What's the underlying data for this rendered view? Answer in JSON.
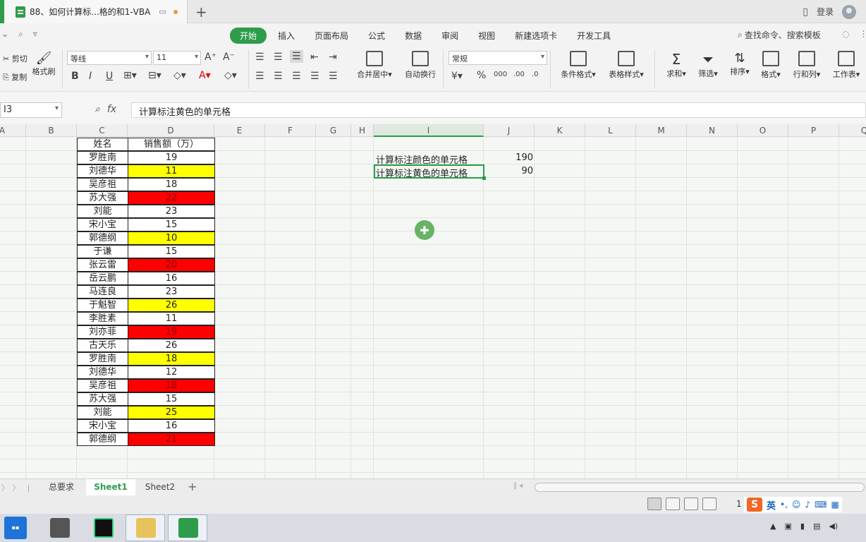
{
  "tab": {
    "title": "88、如何计算标...格的和1-VBA",
    "login": "登录"
  },
  "menu": {
    "left": [
      "⌄",
      "⌕",
      "▿"
    ],
    "items": [
      "开始",
      "插入",
      "页面布局",
      "公式",
      "数据",
      "审阅",
      "视图",
      "新建选项卡",
      "开发工具"
    ],
    "active": "开始",
    "search": "查找命令、搜索模板"
  },
  "ribbon": {
    "cut": "剪切",
    "copy": "复制",
    "format_painter": "格式刷",
    "font": "等线",
    "font_size": "11",
    "number_format": "常规",
    "merge": "合并居中",
    "wrap": "自动换行",
    "cond_format": "条件格式",
    "table_style": "表格样式",
    "sum": "求和",
    "filter": "筛选",
    "sort": "排序",
    "format": "格式",
    "rowcol": "行和列",
    "worksheet": "工作表",
    "bold": "B",
    "italic": "I",
    "underline": "U",
    "percent": "%"
  },
  "formula_bar": {
    "cell_ref": "I3",
    "fx": "fx",
    "content": "计算标注黄色的单元格"
  },
  "columns": [
    "A",
    "B",
    "C",
    "D",
    "E",
    "F",
    "G",
    "H",
    "I",
    "J",
    "K",
    "L",
    "M",
    "N",
    "O",
    "P",
    "Q"
  ],
  "table": {
    "header_name": "姓名",
    "header_sales": "销售额（万）",
    "rows": [
      {
        "name": "罗胜南",
        "value": "19",
        "fill": "none"
      },
      {
        "name": "刘德华",
        "value": "11",
        "fill": "yellow"
      },
      {
        "name": "吴彦祖",
        "value": "18",
        "fill": "none"
      },
      {
        "name": "苏大强",
        "value": "22",
        "fill": "red"
      },
      {
        "name": "刘能",
        "value": "23",
        "fill": "none"
      },
      {
        "name": "宋小宝",
        "value": "15",
        "fill": "none"
      },
      {
        "name": "郭德纲",
        "value": "10",
        "fill": "yellow"
      },
      {
        "name": "于谦",
        "value": "15",
        "fill": "none"
      },
      {
        "name": "张云雷",
        "value": "20",
        "fill": "red"
      },
      {
        "name": "岳云鹏",
        "value": "16",
        "fill": "none"
      },
      {
        "name": "马连良",
        "value": "23",
        "fill": "none"
      },
      {
        "name": "于魁智",
        "value": "26",
        "fill": "yellow"
      },
      {
        "name": "李胜素",
        "value": "11",
        "fill": "none"
      },
      {
        "name": "刘亦菲",
        "value": "19",
        "fill": "red"
      },
      {
        "name": "古天乐",
        "value": "26",
        "fill": "none"
      },
      {
        "name": "罗胜南",
        "value": "18",
        "fill": "yellow"
      },
      {
        "name": "刘德华",
        "value": "12",
        "fill": "none"
      },
      {
        "name": "吴彦祖",
        "value": "18",
        "fill": "red"
      },
      {
        "name": "苏大强",
        "value": "15",
        "fill": "none"
      },
      {
        "name": "刘能",
        "value": "25",
        "fill": "yellow"
      },
      {
        "name": "宋小宝",
        "value": "16",
        "fill": "none"
      },
      {
        "name": "郭德纲",
        "value": "21",
        "fill": "red"
      }
    ]
  },
  "side": {
    "i2": "计算标注颜色的单元格",
    "j2": "190",
    "i3": "计算标注黄色的单元格",
    "j3": "90"
  },
  "sheets": [
    "总要求",
    "Sheet1",
    "Sheet2"
  ],
  "active_sheet": "Sheet1",
  "status": {
    "zoom": "1",
    "ime_lang": "英"
  },
  "colors": {
    "accent": "#2e9c4a",
    "yellow": "#ffff00",
    "red": "#ff0000"
  }
}
